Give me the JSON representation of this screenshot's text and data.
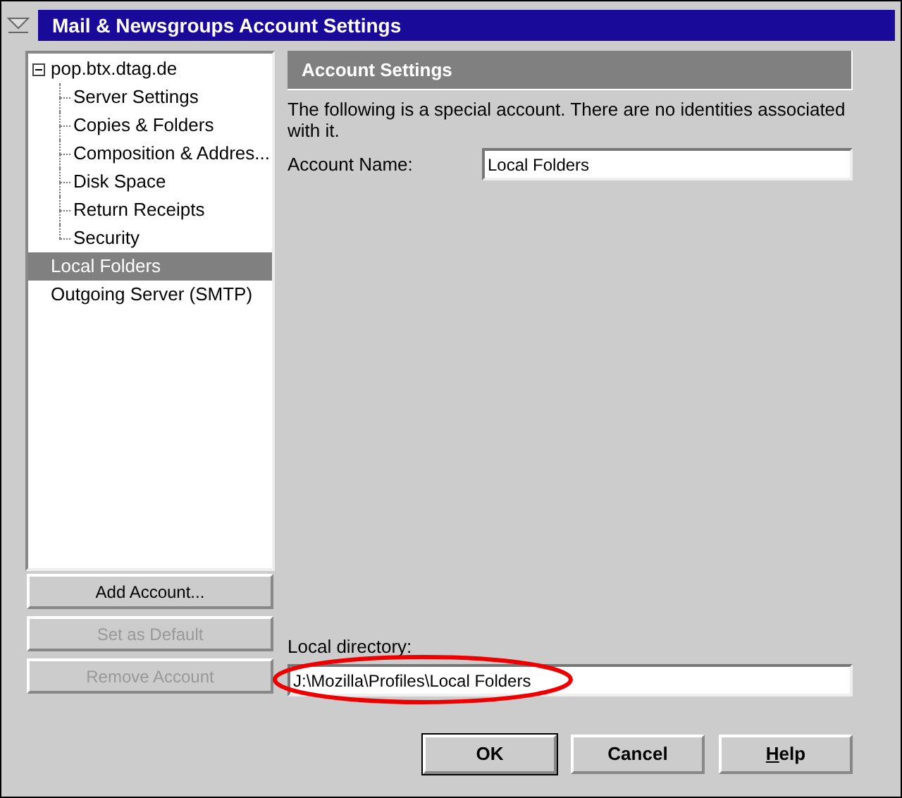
{
  "window": {
    "title": "Mail & Newsgroups Account Settings"
  },
  "accounts": [
    {
      "label": "pop.btx.dtag.de",
      "expanded": true,
      "selected": false,
      "children": [
        {
          "label": "Server Settings",
          "selected": false
        },
        {
          "label": "Copies & Folders",
          "selected": false
        },
        {
          "label": "Composition & Addres...",
          "selected": false
        },
        {
          "label": "Disk Space",
          "selected": false
        },
        {
          "label": "Return Receipts",
          "selected": false
        },
        {
          "label": "Security",
          "selected": false
        }
      ]
    },
    {
      "label": "Local Folders",
      "selected": true
    },
    {
      "label": "Outgoing Server (SMTP)",
      "selected": false
    }
  ],
  "account_buttons": [
    {
      "label": "Add Account...",
      "disabled": false
    },
    {
      "label": "Set as Default",
      "disabled": true
    },
    {
      "label": "Remove Account",
      "disabled": true
    }
  ],
  "panel": {
    "header": "Account Settings",
    "description": "The following is a special account. There are no identities associated with it.",
    "account_name": {
      "label": "Account Name:",
      "value": "Local Folders"
    },
    "local_directory": {
      "label": "Local directory:",
      "value": "J:\\Mozilla\\Profiles\\Local Folders",
      "circled": true
    }
  },
  "dialog_buttons": [
    {
      "label": "OK",
      "default": true
    },
    {
      "label": "Cancel",
      "default": false
    },
    {
      "accel": "H",
      "rest": "elp",
      "default": false
    }
  ]
}
